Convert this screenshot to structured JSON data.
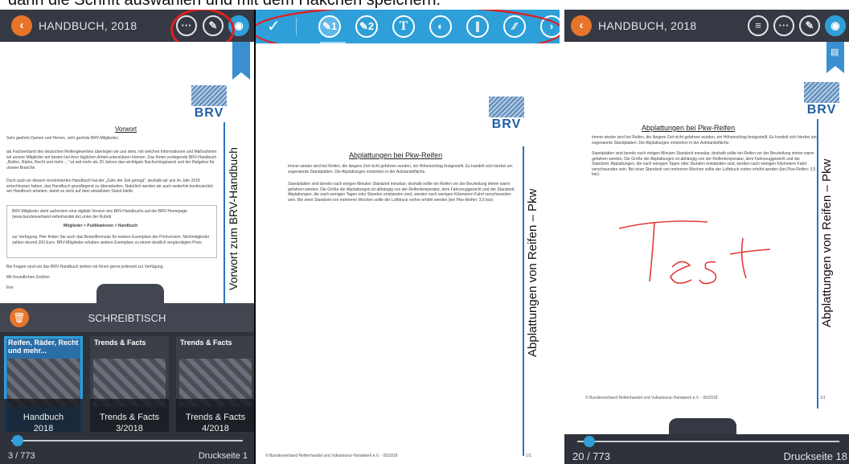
{
  "caption": "dann die Schrift auswählen und mit dem Häkchen speichern.",
  "left": {
    "title": "HANDBUCH, 2018",
    "page_heading": "Vorwort",
    "vertical_title": "Vorwort zum BRV-Handbuch",
    "logo_text": "BRV",
    "para1": "Sehr geehrte Damen und Herren, sehr geehrte BRV-Mitglieder,",
    "para2": "als Fachverband des deutschen Reifengewerbes überlegen wir uns stets, mit welchen Informationen und Maßnahmen wir unsere Mitglieder am besten bei ihrer täglichen Arbeit unterstützen können. Das Ihnen vorliegende BRV-Handbuch „Reifen, Räder, Recht und mehr ...“ ist seit mehr als 20 Jahren das wichtigste Nachschlagewerk und der Ratgeber für unsere Branche.",
    "para3": "Doch auch an diesem renommierten Handbuch hat der „Zahn der Zeit genagt“, deshalb wir uns im Jahr 2018 entschlossen haben, das Handbuch grundlegend zu überarbeiten. Natürlich werden wir auch weiterhin kontinuierlich am Handbuch arbeiten, damit es stets auf dem aktuellsten Stand bleibt.",
    "box1": "BRV-Mitglieder steht außerdem eine digitale Version des BRV-Handbuchs auf der BRV-Homepage (www.bundesverband-reifenhandel.de) unter der Rubrik:",
    "box2": "Mitglieder > Publikationen > Handbuch",
    "box3": "zur Verfügung. Hier finden Sie auch das Bestellformular für weitere Exemplare der Printversion. Nichtmitglieder zahlen derzeit 200 Euro. BRV-Mitglieder erhalten weitere Exemplare zu einem deutlich vergünstigten Preis.",
    "para4": "Bei Fragen rund um das BRV-Handbuch stehen wir Ihnen gerne jederzeit zur Verfügung.",
    "para5": "Mit freundlichen Grüßen",
    "para6": "Ihre",
    "drawer_title": "SCHREIBTISCH",
    "books": [
      {
        "cover": "Reifen, Räder, Recht und mehr...",
        "label1": "Handbuch",
        "label2": "2018",
        "badge": "BRV"
      },
      {
        "cover": "Trends & Facts",
        "label1": "Trends & Facts",
        "label2": "3/2018",
        "badge": "BRV"
      },
      {
        "cover": "Trends & Facts",
        "label1": "Trends & Facts",
        "label2": "4/2018",
        "badge": "BRV"
      }
    ],
    "page_counter": "3 / 773",
    "print_page": "Druckseite 1",
    "slider_fraction": 0.003
  },
  "middle": {
    "tools": [
      "✓",
      "✎1",
      "✎2",
      "T",
      "palette",
      "pen",
      "marker"
    ],
    "doc_heading": "Abplattungen bei Pkw-Reifen",
    "vertical_title": "Abplattungen von Reifen – Pkw",
    "logo_text": "BRV",
    "para1": "Immer wieder wird bei Reifen, die längere Zeit nicht gefahren wurden, ein Höhenschlag festgestellt. Es handelt sich hierbei um sogenannte Standplatten. Die Abplattungen entstehen in der Aufstandsfläche.",
    "para2": "Standplatten sind bereits nach einigen Minuten Standzeit messbar, deshalb sollte ein Reifen vor der Beurteilung immer warm gefahren werden. Die Größe der Abplattungen ist abhängig von der Reifentemperatur, dem Fahrzeuggewicht und der Standzeit. Abplattungen, die nach wenigen Tagen oder Stunden entstanden sind, werden nach wenigen Kilometern Fahrt verschwunden sein. Bei einer Standzeit von mehreren Wochen sollte der Luftdruck vorher erhöht werden (bei Pkw-Reifen: 3,5 bar).",
    "footer_left": "© Bundesverband Reifenhandel und Vulkaniseur-Handwerk e.V. - 05/2018",
    "footer_right": "1/1"
  },
  "right": {
    "title": "HANDBUCH, 2018",
    "doc_heading": "Abplattungen bei Pkw-Reifen",
    "vertical_title": "Abplattungen von Reifen – Pkw",
    "logo_text": "BRV",
    "para1": "Immer wieder wird bei Reifen, die längere Zeit nicht gefahren wurden, ein Höhenschlag festgestellt. Es handelt sich hierbei um sogenannte Standplatten. Die Abplattungen entstehen in der Aufstandsfläche.",
    "para2": "Standplatten sind bereits nach einigen Minuten Standzeit messbar, deshalb sollte ein Reifen vor der Beurteilung immer warm gefahren werden. Die Größe der Abplattungen ist abhängig von der Reifentemperatur, dem Fahrzeuggewicht und der Standzeit. Abplattungen, die nach wenigen Tagen oder Stunden entstanden sind, werden nach wenigen Kilometern Fahrt verschwunden sein. Bei einer Standzeit von mehreren Wochen sollte der Luftdruck vorher erhöht werden (bei Pkw-Reifen: 3,5 bar).",
    "handwriting": "Test",
    "footer_left": "© Bundesverband Reifenhandel und Vulkaniseur-Handwerk e.V. - 05/2018",
    "footer_right": "1/1",
    "page_counter": "20 / 773",
    "print_page": "Druckseite 18",
    "slider_fraction": 0.025
  },
  "colors": {
    "accent": "#2e9fd8",
    "orange": "#e8742a",
    "annotation": "#e02020",
    "ink": "#e23a3a",
    "bar": "#353944"
  }
}
